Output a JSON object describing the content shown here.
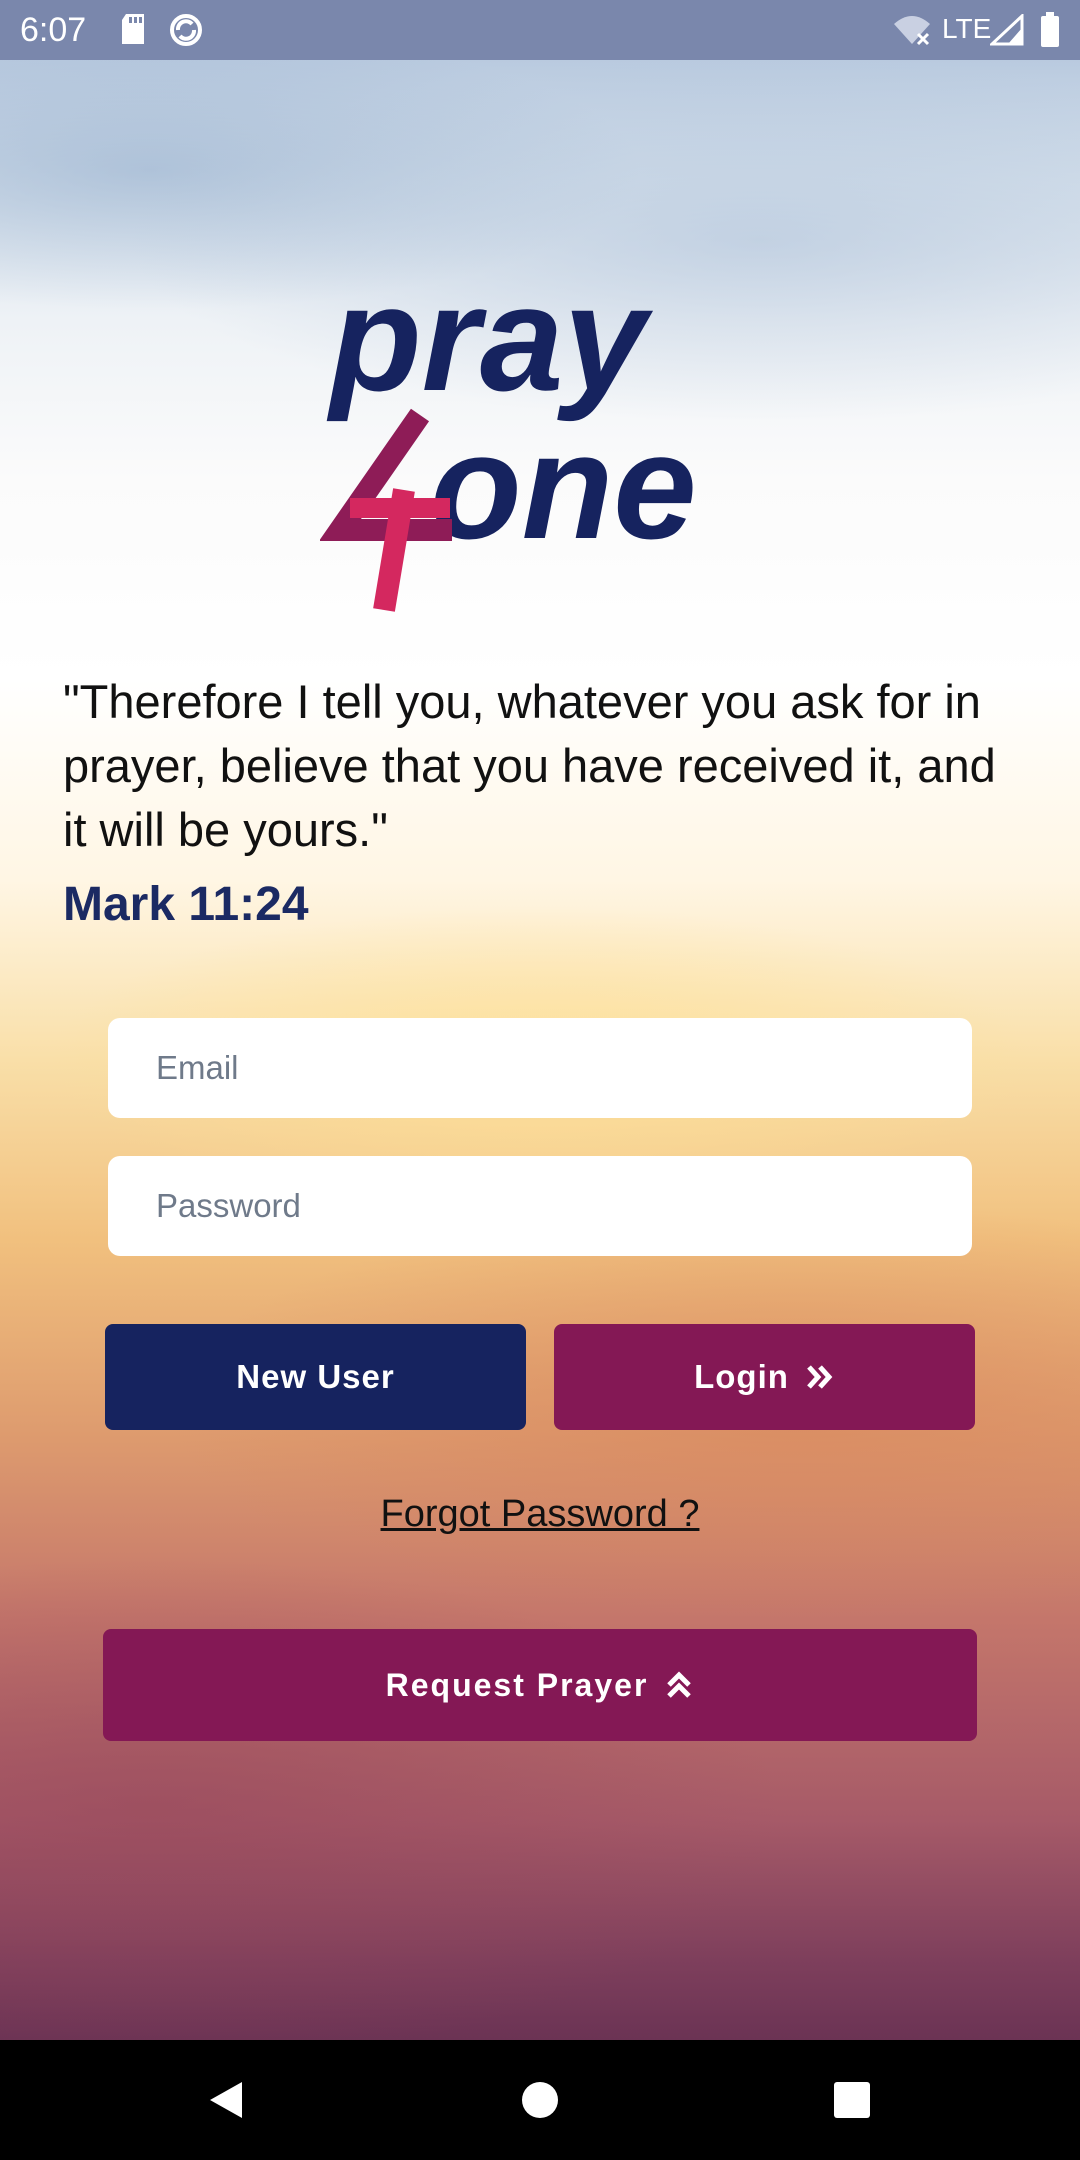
{
  "status_bar": {
    "time": "6:07",
    "network": "LTE",
    "icons": [
      "sd-card-icon",
      "sync-icon",
      "wifi-off-icon",
      "signal-icon",
      "battery-icon"
    ]
  },
  "logo": {
    "text_line1": "pray",
    "text_line2": "one",
    "mark": "4",
    "colors": {
      "navy": "#16235f",
      "magenta": "#d4285f",
      "plum": "#8e1c57"
    }
  },
  "quote": {
    "text": "\"Therefore I tell you, whatever you ask for in prayer, believe that you have received it, and it will be yours.\"",
    "reference": "Mark 11:24"
  },
  "form": {
    "email_placeholder": "Email",
    "password_placeholder": "Password"
  },
  "buttons": {
    "new_user": "New User",
    "login": "Login",
    "forgot_password": "Forgot Password ?",
    "request_prayer": "Request Prayer"
  },
  "colors": {
    "primary_navy": "#16235f",
    "primary_plum": "#841855"
  },
  "nav_bar": {
    "icons": [
      "back-icon",
      "home-icon",
      "recents-icon"
    ]
  }
}
